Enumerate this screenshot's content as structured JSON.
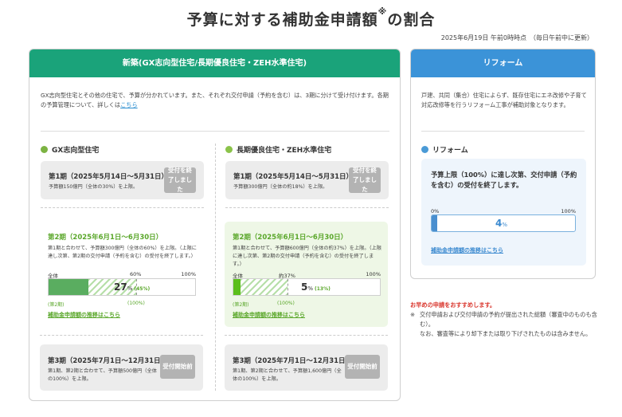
{
  "page": {
    "title": "予算に対する補助金申請額",
    "title_mark": "※",
    "title_suffix": "の割合",
    "timestamp": "2025年6月19日 午前0時時点　（毎日午前中に更新）"
  },
  "new_build": {
    "header": "新築(GX志向型住宅/長期優良住宅・ZEH水準住宅)",
    "intro": "GX志向型住宅とその他の住宅で、予算が分かれています。また、それぞれ交付申請（予約を含む）は、3期に分けて受け付けます。各期の予算管理について、詳しくは",
    "intro_link": "こちら",
    "gx": {
      "title": "GX志向型住宅",
      "phase1": {
        "title": "第1期（2025年5月14日〜5月31日）",
        "note": "予算額150億円（全体の30%）を上限。",
        "badge": "受付を終了しました"
      },
      "phase2": {
        "title": "第2期（2025年6月1日〜6月30日）",
        "note": "第1期と合わせて、予算額300億円（全体の60%）を上限。（上限に達し次第、第2期の交付申請（予約を含む）の受付を終了します。）",
        "label_all": "全体",
        "label_mid": "60%",
        "label_max": "100%",
        "percent": "27",
        "percent_unit": "%",
        "sub_percent": "(45%)",
        "under_left": "(第2期)",
        "under_right": "(100%)",
        "link": "補助金申請額の推移はこちら"
      },
      "phase3": {
        "title": "第3期（2025年7月1日〜12月31日）",
        "note": "第1期、第2期と合わせて、予算額500億円（全体の100%）を上限。",
        "badge": "受付開始前"
      }
    },
    "long": {
      "title": "長期優良住宅・ZEH水準住宅",
      "phase1": {
        "title": "第1期（2025年5月14日〜5月31日）",
        "note": "予算額300億円（全体の約18%）を上限。",
        "badge": "受付を終了しました"
      },
      "phase2": {
        "title": "第2期（2025年6月1日〜6月30日）",
        "note": "第1期と合わせて、予算額600億円（全体の約37%）を上限。（上限に達し次第、第2期の交付申請（予約を含む）の受付を終了します。）",
        "label_all": "全体",
        "label_mid": "約37%",
        "label_max": "100%",
        "percent": "5",
        "percent_unit": "%",
        "sub_percent": "(13%)",
        "under_left": "(第2期)",
        "under_right": "(100%)",
        "link": "補助金申請額の推移はこちら"
      },
      "phase3": {
        "title": "第3期（2025年7月1日〜12月31日）",
        "note": "第1期、第2期と合わせて、予算額1,600億円（全体の100%）を上限。",
        "badge": "受付開始前"
      }
    }
  },
  "reform": {
    "header": "リフォーム",
    "intro": "戸建、共同（集合）住宅によらず、既存住宅にエネ改修や子育て対応改修等を行うリフォーム工事が補助対象となります。",
    "title": "リフォーム",
    "message": "予算上限（100%）に達し次第、交付申請（予約を含む）の受付を終了します。",
    "label_min": "0%",
    "label_max": "100%",
    "percent": "4",
    "percent_unit": "%",
    "link": "補助金申請額の推移はこちら"
  },
  "notes": {
    "headline": "お早めの申請をおすすめします。",
    "mark": "※",
    "line1": "交付申請および交付申請の予約が提出された総額（審査中のものも含む）。",
    "line2": "なお、審査等により却下または取り下げされたものは含みません。"
  },
  "progress": {
    "gx_phase2_overall": 0.27,
    "gx_phase2_cap": 0.6,
    "long_phase2_overall": 0.05,
    "long_phase2_cap": 0.37,
    "reform_overall": 0.04
  },
  "colors": {
    "new_header": "#1aa37a",
    "reform_header": "#3b93d8",
    "green_fill": "#5aad60",
    "blue_fill": "#4a8fcf",
    "note_red": "#d9342b"
  }
}
